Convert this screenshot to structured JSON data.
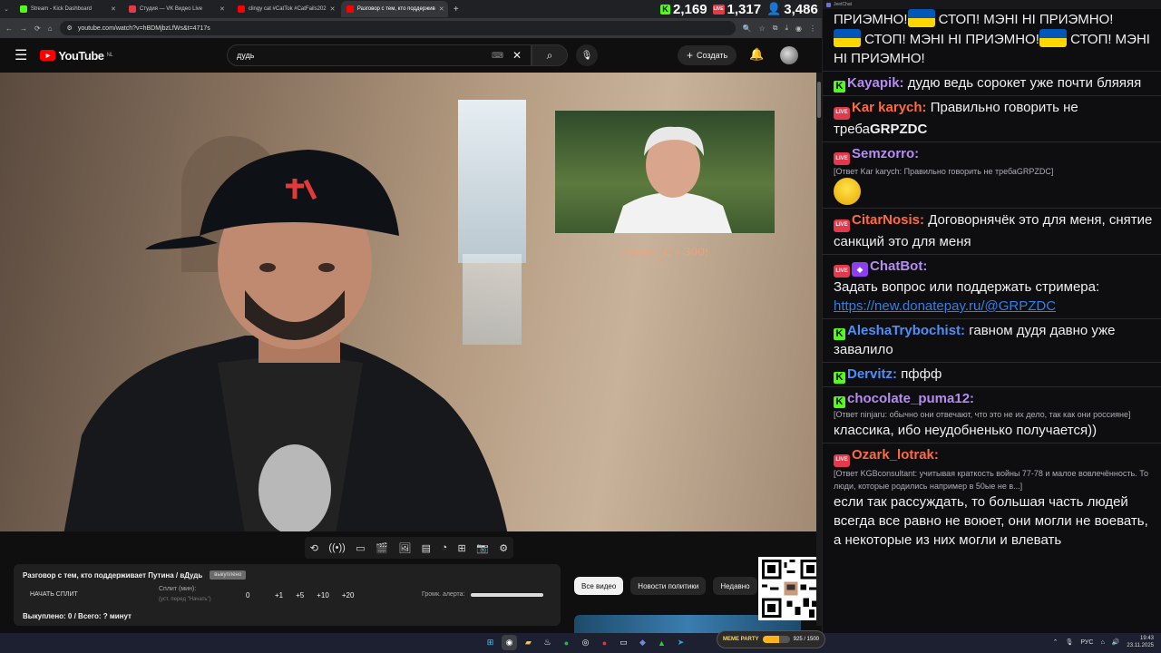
{
  "browser": {
    "tabs": [
      {
        "title": "Stream - Kick Dashboard",
        "color": "#53fc18"
      },
      {
        "title": "Студия — VK Видео Live",
        "color": "#e63946"
      },
      {
        "title": "clingy cat #CatTok #CatFails202",
        "color": "#ff0000"
      },
      {
        "title": "Разговор с тем, кто поддержив",
        "color": "#ff0000"
      }
    ],
    "url": "youtube.com/watch?v=hBDMjbzLfWs&t=4717s"
  },
  "stats": {
    "kick": "2,169",
    "vk": "1,317",
    "viewers": "3,486"
  },
  "youtube": {
    "logo_text": "YouTube",
    "region": "NL",
    "search_value": "дудь",
    "create_label": "Создать"
  },
  "video": {
    "donation_text": "Jester_C - 300!"
  },
  "split": {
    "title": "Разговор с тем, кто поддерживает Путина / вДудь",
    "tag": "выкуплено",
    "start_label": "НАЧАТЬ СПЛИТ",
    "split_label": "Сплит (мин):",
    "split_sub": "(уст. перед \"Начать\")",
    "zero": "0",
    "adds": [
      "+1",
      "+5",
      "+10",
      "+20"
    ],
    "volume_label": "Громк. алерта:",
    "status": "Выкуплено: 0 / Всего: ? минут"
  },
  "chips": [
    "Все видео",
    "Новости политики",
    "Недавно"
  ],
  "chat": {
    "window_title": "JeetChat",
    "messages": [
      {
        "type": "text-top",
        "text1": "ПРИЭМНО!",
        "text2": " СТОП! МЭНІ НІ ПРИЭМНО!",
        "text3": " СТОП! МЭНІ НІ ПРИЭМНО!",
        "text4": " СТОП! МЭНІ НІ ПРИЭМНО!"
      },
      {
        "platform": "kick",
        "user": "Kayapik:",
        "color": "#b48cf2",
        "text": "дудю ведь сорокет уже почти бляяяя"
      },
      {
        "platform": "vk",
        "user": "Kar karych:",
        "color": "#ff6a3d",
        "text": "Правильно говорить не треба",
        "bold": "GRPZDC"
      },
      {
        "platform": "vk",
        "user": "Semzorro:",
        "color": "#b48cf2",
        "reply": "[Ответ Kar karych: Правильно говорить не требаGRPZDC]"
      },
      {
        "platform": "vk",
        "user": "CitarNosis:",
        "color": "#ff6a3d",
        "text": "Договорнячёк это для меня, снятие санкций это для меня"
      },
      {
        "platform": "vk",
        "user": "ChatBot:",
        "color": "#b48cf2",
        "text": "Задать вопрос или поддержать стримера:",
        "link": "https://new.donatepay.ru/@GRPZDC"
      },
      {
        "platform": "kick",
        "user": "AleshaTrybochist:",
        "color": "#4f8ef7",
        "text": "гавном дудя давно уже завалило"
      },
      {
        "platform": "kick",
        "user": "Dervitz:",
        "color": "#4f8ef7",
        "text": "пффф"
      },
      {
        "platform": "kick",
        "user": "chocolate_puma12:",
        "color": "#b48cf2",
        "reply": "[Ответ ninjaru: обычно они отвечают, что это не их дело, так как они россияне]",
        "text": "классика, ибо неудобненько получается))"
      },
      {
        "platform": "vk",
        "user": "Ozark_lotrak:",
        "color": "#ff6a3d",
        "reply": "[Ответ KGBconsultant: учитывая краткость войны 77-78 и малое вовлечённость. То люди, которые родились например в 50ые не в...]",
        "text": "если так рассуждать, то большая часть людей всегда все равно не воюет, они могли не воевать, а некоторые из них могли и влевать"
      }
    ]
  },
  "taskbar": {
    "meme_label": "MEME PARTY",
    "meme_progress": "925 / 1500",
    "meme_fraction": 0.62,
    "lang": "РУС",
    "time": "19:43",
    "date": "23.11.2025"
  }
}
